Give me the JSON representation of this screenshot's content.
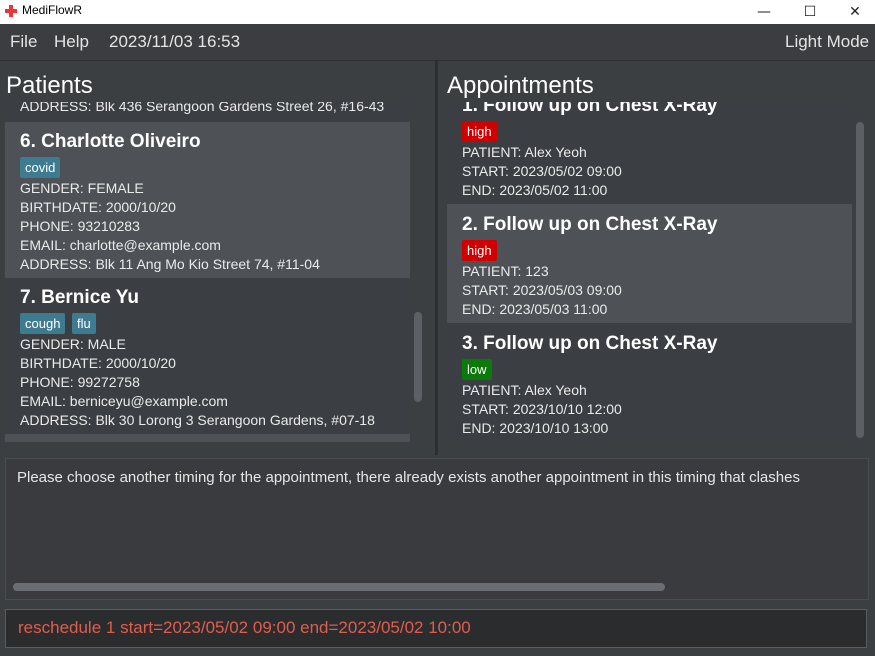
{
  "window": {
    "title": "MediFlowR",
    "minimize": "—",
    "maximize": "☐",
    "close": "✕"
  },
  "menu": {
    "file": "File",
    "help": "Help",
    "datetime": "2023/11/03 16:53",
    "mode": "Light Mode"
  },
  "patients": {
    "title": "Patients",
    "partial_address": "ADDRESS: Blk 436 Serangoon Gardens Street 26, #16-43",
    "items": [
      {
        "name": "6.  Charlotte Oliveiro",
        "tags": [
          "covid"
        ],
        "gender": "GENDER: FEMALE",
        "birthdate": "BIRTHDATE: 2000/10/20",
        "phone": "PHONE: 93210283",
        "email": "EMAIL: charlotte@example.com",
        "address": "ADDRESS: Blk 11 Ang Mo Kio Street 74, #11-04"
      },
      {
        "name": "7.  Bernice Yu",
        "tags": [
          "cough",
          "flu"
        ],
        "gender": "GENDER: MALE",
        "birthdate": "BIRTHDATE: 2000/10/20",
        "phone": "PHONE: 99272758",
        "email": "EMAIL: berniceyu@example.com",
        "address": "ADDRESS: Blk 30 Lorong 3 Serangoon Gardens, #07-18"
      }
    ]
  },
  "appointments": {
    "title": "Appointments",
    "items": [
      {
        "name": "1.  Follow up on Chest X-Ray",
        "priority": "high",
        "patient": "PATIENT: Alex Yeoh",
        "start": "START: 2023/05/02 09:00",
        "end": "END: 2023/05/02 11:00"
      },
      {
        "name": "2.  Follow up on Chest X-Ray",
        "priority": "high",
        "patient": "PATIENT: 123",
        "start": "START: 2023/05/03 09:00",
        "end": "END: 2023/05/03 11:00"
      },
      {
        "name": "3.  Follow up on Chest X-Ray",
        "priority": "low",
        "patient": "PATIENT: Alex Yeoh",
        "start": "START: 2023/10/10 12:00",
        "end": "END: 2023/10/10 13:00"
      }
    ]
  },
  "result": {
    "message": "Please choose another timing for the appointment, there already exists another appointment in this timing that clashes"
  },
  "command": {
    "value": "reschedule 1 start=2023/05/02 09:00 end=2023/05/02 10:00"
  },
  "colors": {
    "tag_blue": "#3e7b91",
    "priority_high": "#d00000",
    "priority_low": "#0a7a0a",
    "command_text": "#e05d4e"
  }
}
